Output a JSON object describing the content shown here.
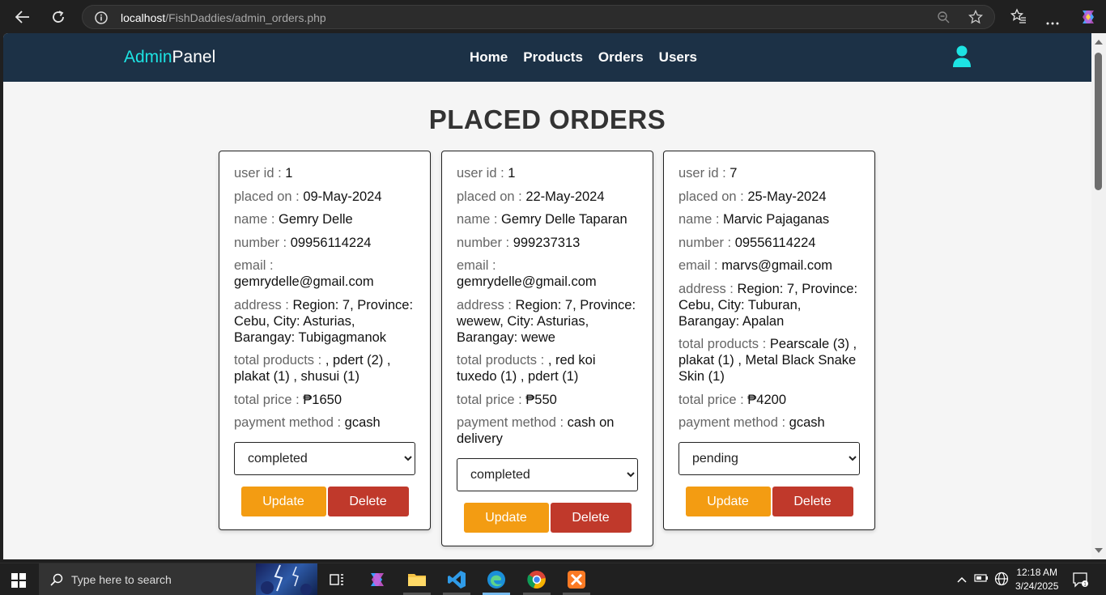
{
  "browser": {
    "url_host": "localhost",
    "url_path": "/FishDaddies/admin_orders.php"
  },
  "header": {
    "logo_admin": "Admin",
    "logo_panel": "Panel",
    "nav": [
      "Home",
      "Products",
      "Orders",
      "Users"
    ]
  },
  "page": {
    "title": "PLACED ORDERS"
  },
  "labels": {
    "user_id": "user id : ",
    "placed_on": "placed on : ",
    "name": "name : ",
    "number": "number : ",
    "email": "email : ",
    "address": "address : ",
    "total_products": "total products : ",
    "total_price": "total price : ",
    "payment_method": "payment method : ",
    "update": "Update",
    "delete": "Delete"
  },
  "orders": [
    {
      "user_id": "1",
      "placed_on": "09-May-2024",
      "name": "Gemry Delle",
      "number": "09956114224",
      "email": "gemrydelle@gmail.com",
      "address": "Region: 7, Province: Cebu, City: Asturias, Barangay: Tubigagmanok",
      "total_products": ", pdert (2) , plakat (1) , shusui (1)",
      "total_price": "₱1650",
      "payment_method": "gcash",
      "status": "completed"
    },
    {
      "user_id": "1",
      "placed_on": "22-May-2024",
      "name": "Gemry Delle Taparan",
      "number": "999237313",
      "email": "gemrydelle@gmail.com",
      "address": "Region: 7, Province: wewew, City: Asturias, Barangay: wewe",
      "total_products": ", red koi tuxedo (1) , pdert (1)",
      "total_price": "₱550",
      "payment_method": "cash on delivery",
      "status": "completed"
    },
    {
      "user_id": "7",
      "placed_on": "25-May-2024",
      "name": "Marvic Pajaganas",
      "number": "09556114224",
      "email": "marvs@gmail.com",
      "address": "Region: 7, Province: Cebu, City: Tuburan, Barangay: Apalan",
      "total_products": "Pearscale (3) , plakat (1) , Metal Black Snake Skin (1)",
      "total_price": "₱4200",
      "payment_method": "gcash",
      "status": "pending"
    }
  ],
  "taskbar": {
    "search_placeholder": "Type here to search",
    "time": "12:18 AM",
    "date": "3/24/2025"
  },
  "colors": {
    "header_bg": "#1c3146",
    "accent_cyan": "#1de3e3",
    "update_btn": "#f39c12",
    "delete_btn": "#c0392b"
  }
}
